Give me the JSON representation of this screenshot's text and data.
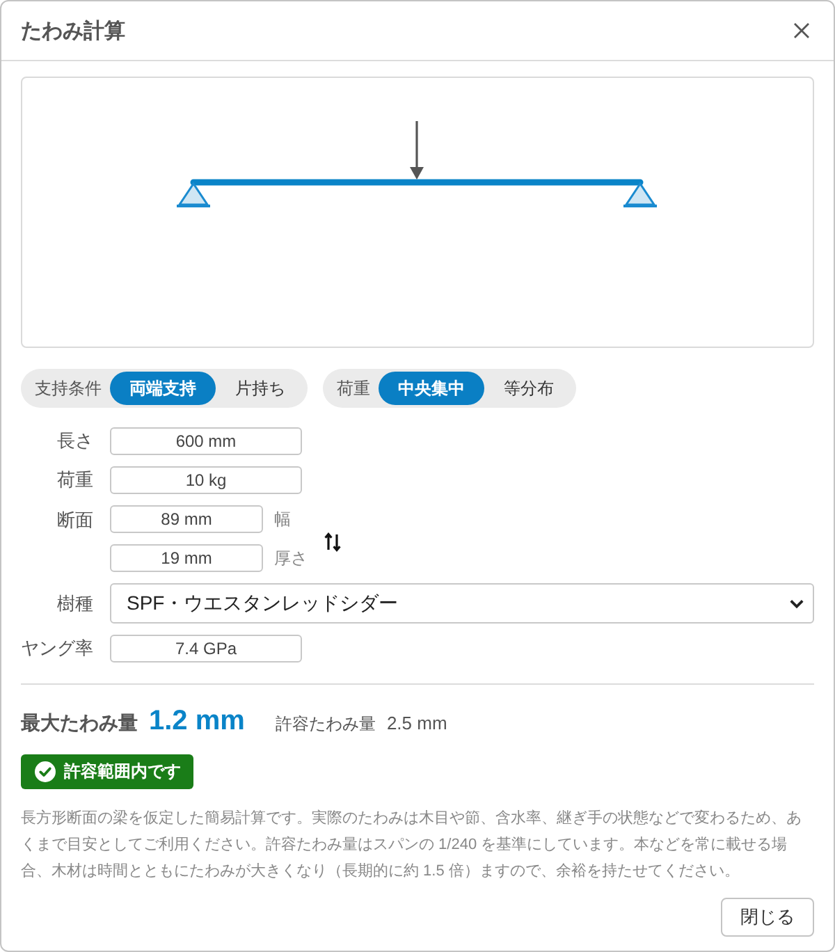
{
  "dialog": {
    "title": "たわみ計算"
  },
  "toggles": [
    {
      "label": "支持条件",
      "options": [
        {
          "label": "両端支持",
          "selected": true
        },
        {
          "label": "片持ち",
          "selected": false
        }
      ]
    },
    {
      "label": "荷重",
      "options": [
        {
          "label": "中央集中",
          "selected": true
        },
        {
          "label": "等分布",
          "selected": false
        }
      ]
    }
  ],
  "form": [
    {
      "kind": "input",
      "label": "長さ",
      "value": "600 mm"
    },
    {
      "kind": "input",
      "label": "荷重",
      "value": "10 kg"
    },
    {
      "kind": "pair",
      "label": "断面",
      "fields": [
        {
          "value": "89 mm",
          "suffix": "幅"
        },
        {
          "value": "19 mm",
          "suffix": "厚さ"
        }
      ]
    },
    {
      "kind": "select",
      "label": "樹種",
      "value": "SPF・ウエスタンレッドシダー"
    },
    {
      "kind": "input",
      "label": "ヤング率",
      "value": "7.4 GPa"
    }
  ],
  "result": {
    "label": "最大たわみ量",
    "value": "1.2 mm",
    "allowable_label": "許容たわみ量",
    "allowable_value": "2.5 mm"
  },
  "status": {
    "kind": "ok",
    "text": "許容範囲内です"
  },
  "note": "長方形断面の梁を仮定した簡易計算です。実際のたわみは木目や節、含水率、継ぎ手の状態などで変わるため、あくまで目安としてご利用ください。許容たわみ量はスパンの 1/240 を基準にしています。本などを常に載せる場合、木材は時間とともにたわみが大きくなり（長期的に約 1.5 倍）ますので、余裕を持たせてください。",
  "buttons": [
    {
      "label": "閉じる"
    }
  ]
}
